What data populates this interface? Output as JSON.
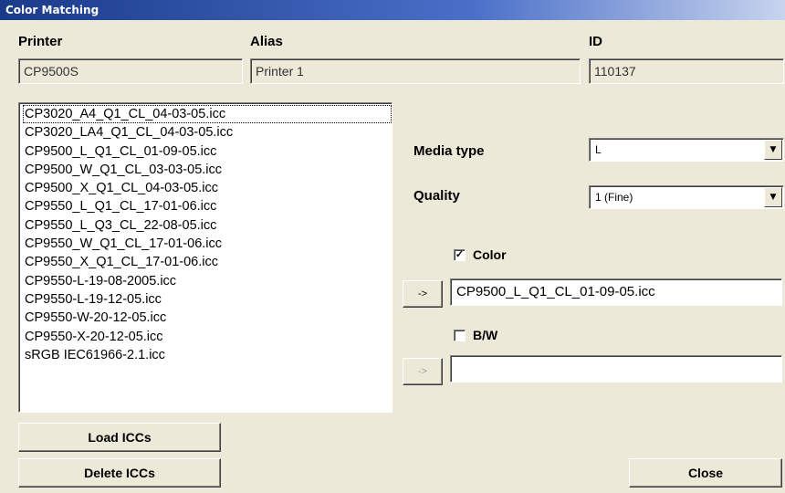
{
  "window": {
    "title": "Color Matching"
  },
  "header": {
    "printer_label": "Printer",
    "alias_label": "Alias",
    "id_label": "ID",
    "printer_value": "CP9500S",
    "alias_value": "Printer 1",
    "id_value": "110137"
  },
  "icc_list": {
    "items": [
      "CP3020_A4_Q1_CL_04-03-05.icc",
      "CP3020_LA4_Q1_CL_04-03-05.icc",
      "CP9500_L_Q1_CL_01-09-05.icc",
      "CP9500_W_Q1_CL_03-03-05.icc",
      "CP9500_X_Q1_CL_04-03-05.icc",
      "CP9550_L_Q1_CL_17-01-06.icc",
      "CP9550_L_Q3_CL_22-08-05.icc",
      "CP9550_W_Q1_CL_17-01-06.icc",
      "CP9550_X_Q1_CL_17-01-06.icc",
      "CP9550-L-19-08-2005.icc",
      "CP9550-L-19-12-05.icc",
      "CP9550-W-20-12-05.icc",
      "CP9550-X-20-12-05.icc",
      "sRGB IEC61966-2.1.icc"
    ]
  },
  "settings": {
    "media_type_label": "Media type",
    "media_type_value": "L",
    "quality_label": "Quality",
    "quality_value": "1 (Fine)"
  },
  "color": {
    "label": "Color",
    "checked": true,
    "check_glyph": "✓",
    "assign_label": "->",
    "value": "CP9500_L_Q1_CL_01-09-05.icc"
  },
  "bw": {
    "label": "B/W",
    "checked": false,
    "assign_label": "->",
    "value": ""
  },
  "buttons": {
    "load": "Load ICCs",
    "delete": "Delete ICCs",
    "close": "Close"
  },
  "icons": {
    "dropdown": "chevron-down-icon",
    "checkmark": "checkmark-icon"
  }
}
